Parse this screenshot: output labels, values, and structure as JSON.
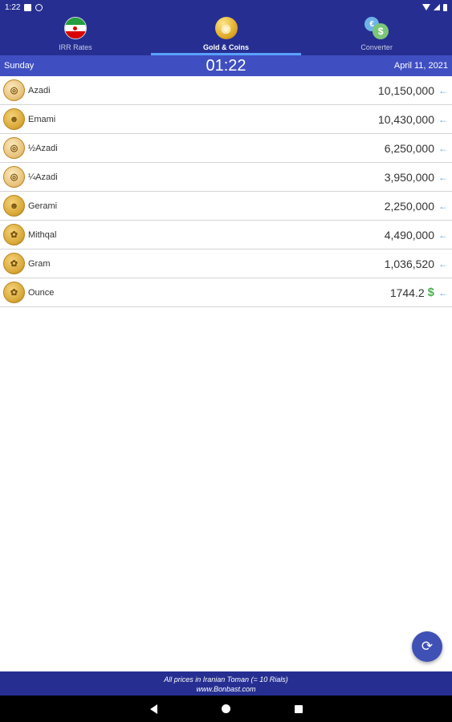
{
  "status_bar": {
    "time": "1:22"
  },
  "tabs": [
    {
      "label": "IRR Rates",
      "icon": "iran-flag-icon"
    },
    {
      "label": "Gold & Coins",
      "icon": "gold-coin-icon",
      "active": true
    },
    {
      "label": "Converter",
      "icon": "currency-converter-icon"
    }
  ],
  "header": {
    "day": "Sunday",
    "time": "01:22",
    "date": "April 11, 2021"
  },
  "coins": [
    {
      "name": "Azadi",
      "price": "10,150,000"
    },
    {
      "name": "Emami",
      "price": "10,430,000"
    },
    {
      "name": "½Azadi",
      "price": "6,250,000"
    },
    {
      "name": "¼Azadi",
      "price": "3,950,000"
    },
    {
      "name": "Gerami",
      "price": "2,250,000"
    },
    {
      "name": "Mithqal",
      "price": "4,490,000"
    },
    {
      "name": "Gram",
      "price": "1,036,520"
    },
    {
      "name": "Ounce",
      "price": "1744.2"
    }
  ],
  "footer": {
    "line1": "All prices in Iranian Toman (= 10 Rials)",
    "line2": "www.Bonbast.com"
  },
  "colors": {
    "bar": "#262f91",
    "subheader": "#3f4fc2",
    "accent": "#5aa0ff",
    "fab": "#3f51b5"
  }
}
